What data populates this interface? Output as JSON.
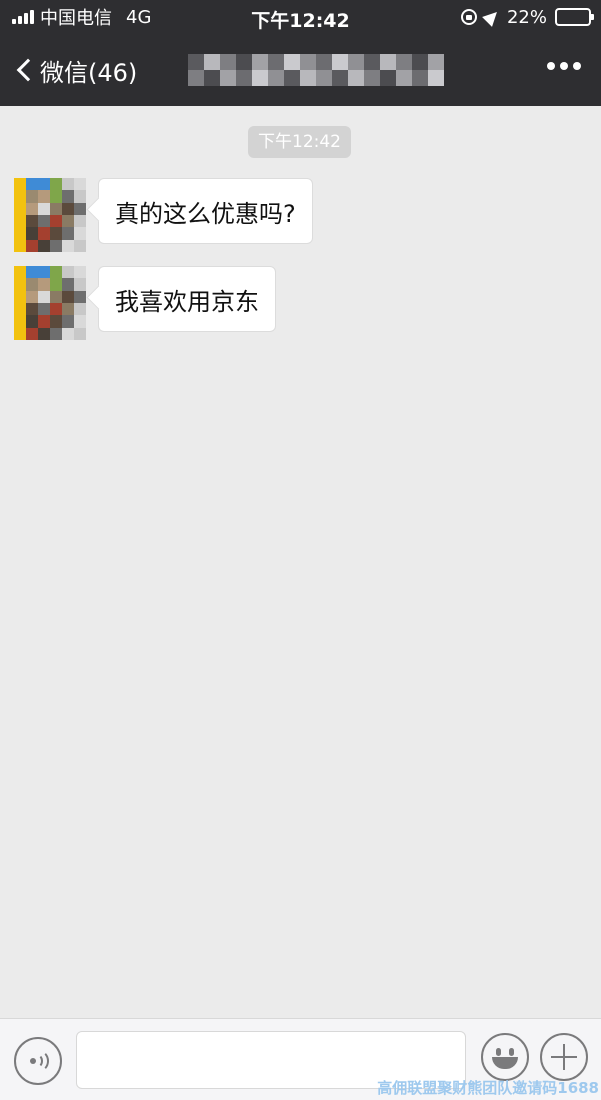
{
  "status_bar": {
    "carrier": "中国电信",
    "network": "4G",
    "time": "下午12:42",
    "battery_percent": "22%",
    "battery_level": 0.22,
    "icons": [
      "signal-icon",
      "rotation-lock-icon",
      "location-icon",
      "battery-icon"
    ]
  },
  "nav": {
    "back_label": "微信(46)",
    "title_obscured": true,
    "icons": [
      "chevron-left-icon",
      "more-icon"
    ]
  },
  "chat": {
    "timestamp": "下午12:42",
    "messages": [
      {
        "sender": "contact",
        "text": "真的这么优惠吗?"
      },
      {
        "sender": "contact",
        "text": "我喜欢用京东"
      }
    ]
  },
  "input_bar": {
    "icons": [
      "voice-icon",
      "emoji-icon",
      "plus-icon"
    ],
    "text_value": ""
  },
  "watermark": "高佣联盟聚财熊团队邀请码1688",
  "colors": {
    "header_bg": "#2e2e31",
    "chat_bg": "#ebebeb",
    "bubble_bg": "#ffffff",
    "input_bar_bg": "#f5f5f7",
    "watermark": "#9ec9ee"
  }
}
